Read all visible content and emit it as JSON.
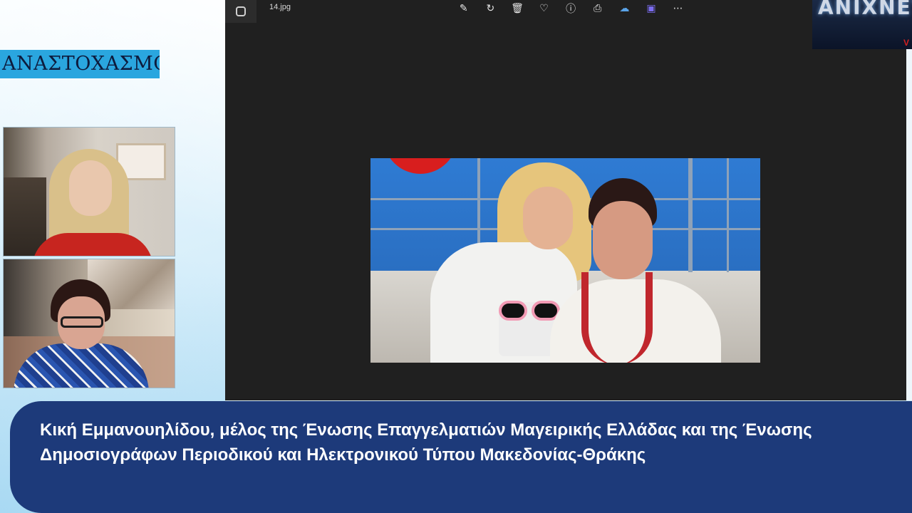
{
  "show_title": "ΑΝΑΣΤΟΧΑΣΜΟΙ",
  "participants": [
    {
      "name": "participant-1"
    },
    {
      "name": "participant-2"
    }
  ],
  "viewer": {
    "filename": "14.jpg",
    "toolbar_icons": [
      "edit-image-icon",
      "rotate-icon",
      "delete-icon",
      "favorite-icon",
      "info-icon",
      "print-icon",
      "onedrive-icon",
      "clipchamp-icon",
      "more-options-icon"
    ],
    "toolbar_glyphs": [
      "✎",
      "↻",
      "🗑",
      "♡",
      "ⓘ",
      "⎙",
      "☁",
      "▣",
      "⋯"
    ]
  },
  "channel_logo": {
    "text": "ΑΝΙΧΝΕΥΣ",
    "corner_letter": "V"
  },
  "caption": "Κική Εμμανουηλίδου, μέλος της Ένωσης Επαγγελματιών Μαγειρικής Ελλάδας και της Ένωσης Δημοσιογράφων Περιοδικού και Ηλεκτρονικού Τύπου Μακεδονίας-Θράκης",
  "colors": {
    "banner": "#2aa6df",
    "caption_bg": "#1d3a7a",
    "viewer_bg": "#202020"
  }
}
